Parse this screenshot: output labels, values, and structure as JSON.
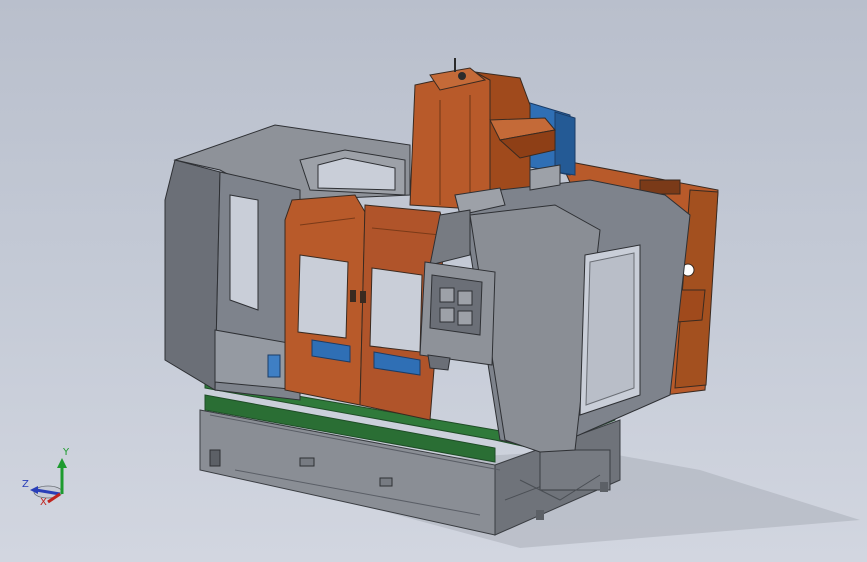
{
  "colors": {
    "background_top": "#b9bfcc",
    "background_bottom": "#d2d6e0",
    "enclosure_gray": "#7e838c",
    "enclosure_dark": "#5a5e66",
    "column_orange": "#b85a2a",
    "table_blue": "#2f6fb5",
    "base_green": "#2f7a3a",
    "base_gray": "#8a8e95"
  },
  "triad": {
    "y_label": "Y",
    "z_label": "Z",
    "x_label": "X",
    "y_color": "#1e9b2f",
    "z_color": "#2a3fb8",
    "x_color": "#c0241e"
  }
}
